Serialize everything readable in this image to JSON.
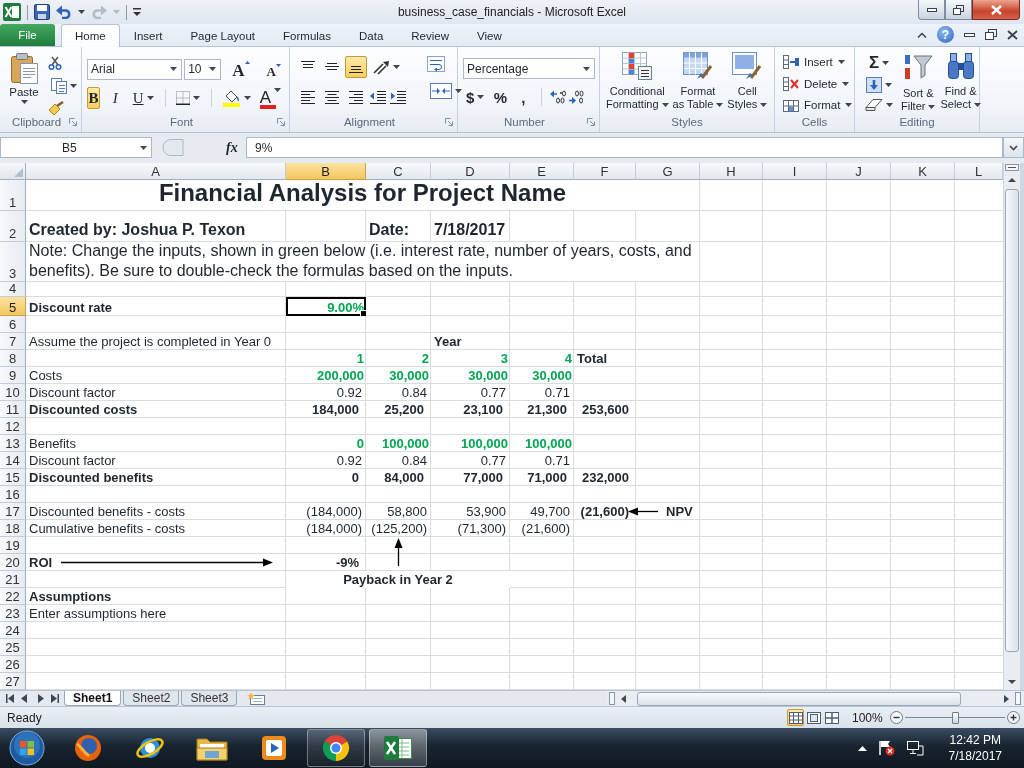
{
  "window": {
    "title": "business_case_financials - Microsoft Excel",
    "help": "?"
  },
  "ribbon_tabs": [
    {
      "label": "File",
      "kind": "file",
      "selected": false
    },
    {
      "label": "Home",
      "kind": "tab",
      "selected": true
    },
    {
      "label": "Insert",
      "kind": "tab",
      "selected": false
    },
    {
      "label": "Page Layout",
      "kind": "tab",
      "selected": false
    },
    {
      "label": "Formulas",
      "kind": "tab",
      "selected": false
    },
    {
      "label": "Data",
      "kind": "tab",
      "selected": false
    },
    {
      "label": "Review",
      "kind": "tab",
      "selected": false
    },
    {
      "label": "View",
      "kind": "tab",
      "selected": false
    }
  ],
  "ribbon": {
    "clipboard": {
      "label": "Clipboard",
      "paste": "Paste"
    },
    "font": {
      "label": "Font",
      "family": "Arial",
      "size": "10",
      "grow": "A",
      "shrink": "A",
      "styles": [
        {
          "kind": "bold",
          "glyph": "B",
          "selected": true
        },
        {
          "kind": "italic",
          "glyph": "I",
          "selected": false
        },
        {
          "kind": "underline",
          "glyph": "U",
          "selected": false
        }
      ],
      "font_color": "A"
    },
    "alignment": {
      "label": "Alignment",
      "vertical": [
        {
          "kind": "top",
          "selected": false
        },
        {
          "kind": "middle",
          "selected": false
        },
        {
          "kind": "bottom",
          "selected": true
        }
      ],
      "horizontal": [
        {
          "kind": "left",
          "selected": false
        },
        {
          "kind": "center",
          "selected": false
        },
        {
          "kind": "right",
          "selected": false
        }
      ]
    },
    "number": {
      "label": "Number",
      "format": "Percentage",
      "currency": "$",
      "percent": "%",
      "comma": ","
    },
    "styles": {
      "label": "Styles",
      "buttons": [
        {
          "kind": "conditional",
          "lines": [
            "Conditional",
            "Formatting"
          ]
        },
        {
          "kind": "table",
          "lines": [
            "Format",
            "as Table"
          ]
        },
        {
          "kind": "cell_styles",
          "lines": [
            "Cell",
            "Styles"
          ]
        }
      ]
    },
    "cells": {
      "label": "Cells",
      "buttons": [
        {
          "kind": "insert",
          "label": "Insert"
        },
        {
          "kind": "delete",
          "label": "Delete"
        },
        {
          "kind": "format",
          "label": "Format"
        }
      ]
    },
    "editing": {
      "label": "Editing",
      "autosum": "Σ",
      "buttons": [
        {
          "kind": "sort",
          "lines": [
            "Sort &",
            "Filter"
          ]
        },
        {
          "kind": "find",
          "lines": [
            "Find &",
            "Select"
          ]
        }
      ]
    }
  },
  "formula_bar": {
    "name_box": "B5",
    "function_label": "fx",
    "value": "9%"
  },
  "sheet": {
    "columns": [
      {
        "label": "A",
        "selected": false
      },
      {
        "label": "B",
        "selected": true
      },
      {
        "label": "C",
        "selected": false
      },
      {
        "label": "D",
        "selected": false
      },
      {
        "label": "E",
        "selected": false
      },
      {
        "label": "F",
        "selected": false
      },
      {
        "label": "G",
        "selected": false
      },
      {
        "label": "H",
        "selected": false
      },
      {
        "label": "I",
        "selected": false
      },
      {
        "label": "J",
        "selected": false
      },
      {
        "label": "K",
        "selected": false
      },
      {
        "label": "L",
        "selected": false
      }
    ],
    "rows": [
      {
        "label": "1",
        "selected": false,
        "cells": {
          "A": {
            "kind": "title",
            "text": "Financial Analysis for Project Name",
            "selected": false
          }
        }
      },
      {
        "label": "2",
        "selected": false,
        "cells": {
          "A": {
            "kind": "heading",
            "text": "Created by: Joshua P. Texon",
            "selected": false
          },
          "C": {
            "kind": "heading",
            "text": "Date:",
            "selected": false
          },
          "D": {
            "kind": "heading",
            "text": "7/18/2017",
            "selected": false
          }
        }
      },
      {
        "label": "3",
        "selected": false,
        "cells": {
          "A": {
            "kind": "note",
            "text": "Note: Change the inputs, shown in green below (i.e. interest rate, number of years, costs, and benefits). Be sure to double-check the formulas based on the inputs.",
            "selected": false
          }
        }
      },
      {
        "label": "4",
        "selected": false
      },
      {
        "label": "5",
        "selected": true,
        "cells": {
          "A": {
            "kind": "bold_label",
            "text": "Discount rate",
            "selected": false
          },
          "B": {
            "kind": "input",
            "text": "9.00%",
            "selected": true
          }
        }
      },
      {
        "label": "6",
        "selected": false
      },
      {
        "label": "7",
        "selected": false,
        "cells": {
          "A": {
            "kind": "label",
            "text": "Assume the project is completed in Year 0",
            "selected": false
          },
          "D": {
            "kind": "bold_label",
            "text": "Year",
            "selected": false
          }
        }
      },
      {
        "label": "8",
        "selected": false,
        "cells": {
          "B": {
            "kind": "input",
            "text": "1",
            "selected": false
          },
          "C": {
            "kind": "input",
            "text": "2",
            "selected": false
          },
          "D": {
            "kind": "input",
            "text": "3",
            "selected": false
          },
          "E": {
            "kind": "input",
            "text": "4",
            "selected": false
          },
          "F": {
            "kind": "bold_label",
            "text": "Total",
            "selected": false
          }
        }
      },
      {
        "label": "9",
        "selected": false,
        "cells": {
          "A": {
            "kind": "label",
            "text": "Costs",
            "selected": false
          },
          "B": {
            "kind": "input",
            "text": "200,000",
            "selected": false
          },
          "C": {
            "kind": "input",
            "text": "30,000",
            "selected": false
          },
          "D": {
            "kind": "input",
            "text": "30,000",
            "selected": false
          },
          "E": {
            "kind": "input",
            "text": "30,000",
            "selected": false
          }
        }
      },
      {
        "label": "10",
        "selected": false,
        "cells": {
          "A": {
            "kind": "label",
            "text": "Discount factor",
            "selected": false
          },
          "B": {
            "kind": "number",
            "text": "0.92",
            "selected": false
          },
          "C": {
            "kind": "number",
            "text": "0.84",
            "selected": false
          },
          "D": {
            "kind": "number",
            "text": "0.77",
            "selected": false
          },
          "E": {
            "kind": "number",
            "text": "0.71",
            "selected": false
          }
        }
      },
      {
        "label": "11",
        "selected": false,
        "cells": {
          "A": {
            "kind": "bold_label",
            "text": "Discounted costs",
            "selected": false
          },
          "B": {
            "kind": "total",
            "text": "184,000",
            "selected": false
          },
          "C": {
            "kind": "total",
            "text": "25,200",
            "selected": false
          },
          "D": {
            "kind": "total",
            "text": "23,100",
            "selected": false
          },
          "E": {
            "kind": "total",
            "text": "21,300",
            "selected": false
          },
          "F": {
            "kind": "total",
            "text": "253,600",
            "selected": false
          }
        }
      },
      {
        "label": "12",
        "selected": false
      },
      {
        "label": "13",
        "selected": false,
        "cells": {
          "A": {
            "kind": "label",
            "text": "Benefits",
            "selected": false
          },
          "B": {
            "kind": "input",
            "text": "0",
            "selected": false
          },
          "C": {
            "kind": "input",
            "text": "100,000",
            "selected": false
          },
          "D": {
            "kind": "input",
            "text": "100,000",
            "selected": false
          },
          "E": {
            "kind": "input",
            "text": "100,000",
            "selected": false
          }
        }
      },
      {
        "label": "14",
        "selected": false,
        "cells": {
          "A": {
            "kind": "label",
            "text": "Discount factor",
            "selected": false
          },
          "B": {
            "kind": "number",
            "text": "0.92",
            "selected": false
          },
          "C": {
            "kind": "number",
            "text": "0.84",
            "selected": false
          },
          "D": {
            "kind": "number",
            "text": "0.77",
            "selected": false
          },
          "E": {
            "kind": "number",
            "text": "0.71",
            "selected": false
          }
        }
      },
      {
        "label": "15",
        "selected": false,
        "cells": {
          "A": {
            "kind": "bold_label",
            "text": "Discounted benefits",
            "selected": false
          },
          "B": {
            "kind": "total",
            "text": "0",
            "selected": false
          },
          "C": {
            "kind": "total",
            "text": "84,000",
            "selected": false
          },
          "D": {
            "kind": "total",
            "text": "77,000",
            "selected": false
          },
          "E": {
            "kind": "total",
            "text": "71,000",
            "selected": false
          },
          "F": {
            "kind": "total",
            "text": "232,000",
            "selected": false
          }
        }
      },
      {
        "label": "16",
        "selected": false
      },
      {
        "label": "17",
        "selected": false,
        "cells": {
          "A": {
            "kind": "label",
            "text": "Discounted benefits - costs",
            "selected": false
          },
          "B": {
            "kind": "number",
            "text": "(184,000)",
            "selected": false
          },
          "C": {
            "kind": "number",
            "text": "58,800",
            "selected": false
          },
          "D": {
            "kind": "number",
            "text": "53,900",
            "selected": false
          },
          "E": {
            "kind": "number",
            "text": "49,700",
            "selected": false
          },
          "F": {
            "kind": "total",
            "text": "(21,600)",
            "selected": false
          },
          "G": {
            "kind": "pointer_label",
            "text": "NPV",
            "selected": false
          }
        }
      },
      {
        "label": "18",
        "selected": false,
        "cells": {
          "A": {
            "kind": "label",
            "text": "Cumulative benefits - costs",
            "selected": false
          },
          "B": {
            "kind": "number",
            "text": "(184,000)",
            "selected": false
          },
          "C": {
            "kind": "number",
            "text": "(125,200)",
            "selected": false
          },
          "D": {
            "kind": "number",
            "text": "(71,300)",
            "selected": false
          },
          "E": {
            "kind": "number",
            "text": "(21,600)",
            "selected": false
          }
        }
      },
      {
        "label": "19",
        "selected": false
      },
      {
        "label": "20",
        "selected": false,
        "cells": {
          "A": {
            "kind": "bold_label",
            "text": "ROI",
            "selected": false
          },
          "B": {
            "kind": "total",
            "text": "-9%",
            "selected": false
          }
        }
      },
      {
        "label": "21",
        "selected": false,
        "cells": {
          "C": {
            "kind": "caption",
            "text": "Payback in Year 2",
            "selected": false
          }
        }
      },
      {
        "label": "22",
        "selected": false,
        "cells": {
          "A": {
            "kind": "bold_label",
            "text": "Assumptions",
            "selected": false
          }
        }
      },
      {
        "label": "23",
        "selected": false,
        "cells": {
          "A": {
            "kind": "label",
            "text": "Enter assumptions here",
            "selected": false
          }
        }
      },
      {
        "label": "24",
        "selected": false
      },
      {
        "label": "25",
        "selected": false
      },
      {
        "label": "26",
        "selected": false
      },
      {
        "label": "27",
        "selected": false
      }
    ]
  },
  "sheet_tabs": [
    {
      "label": "Sheet1",
      "selected": true
    },
    {
      "label": "Sheet2",
      "selected": false
    },
    {
      "label": "Sheet3",
      "selected": false
    }
  ],
  "status_bar": {
    "status": "Ready",
    "views": [
      {
        "kind": "normal",
        "selected": true
      },
      {
        "kind": "page_layout",
        "selected": false
      },
      {
        "kind": "page_break",
        "selected": false
      }
    ],
    "zoom": "100%",
    "zoom_slider": {
      "level": 0.5
    }
  },
  "taskbar": {
    "apps": [
      {
        "kind": "globe",
        "running": false,
        "selected": false
      },
      {
        "kind": "ringed_globe",
        "running": false,
        "selected": false
      },
      {
        "kind": "folder",
        "running": false,
        "selected": false
      },
      {
        "kind": "player",
        "running": false,
        "selected": false
      },
      {
        "kind": "wheel",
        "running": true,
        "selected": false
      },
      {
        "kind": "spreadsheet",
        "running": true,
        "selected": true
      }
    ],
    "time": "12:42 PM",
    "date": "7/18/2017"
  }
}
